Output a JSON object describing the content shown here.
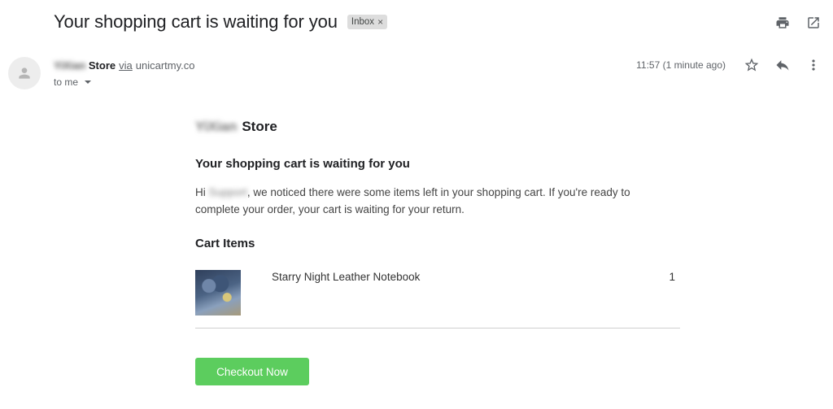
{
  "header": {
    "subject": "Your shopping cart is waiting for you",
    "label": "Inbox",
    "label_remove": "×",
    "icons": [
      "print-icon",
      "open-in-new-window-icon"
    ]
  },
  "message": {
    "sender_blurred": "YiXian",
    "sender_name": "Store",
    "via_label": "via",
    "via_domain": "unicartmy.co",
    "to_label": "to me",
    "time": "11:57 (1 minute ago)",
    "icons": [
      "star-icon",
      "reply-icon",
      "more-vert-icon"
    ]
  },
  "body": {
    "store_blurred": "YiXian",
    "store_name": "Store",
    "heading": "Your shopping cart is waiting for you",
    "greeting": "Hi",
    "name_blurred": "Support",
    "para_rest": ", we noticed there were some items left in your shopping cart. If you're ready to complete your order, your cart is waiting for your return.",
    "cart_heading": "Cart Items",
    "items": [
      {
        "name": "Starry Night Leather Notebook",
        "qty": "1"
      }
    ],
    "checkout_label": "Checkout Now"
  },
  "colors": {
    "checkout_button": "#5ccd5e",
    "label_chip": "#dddddd"
  }
}
